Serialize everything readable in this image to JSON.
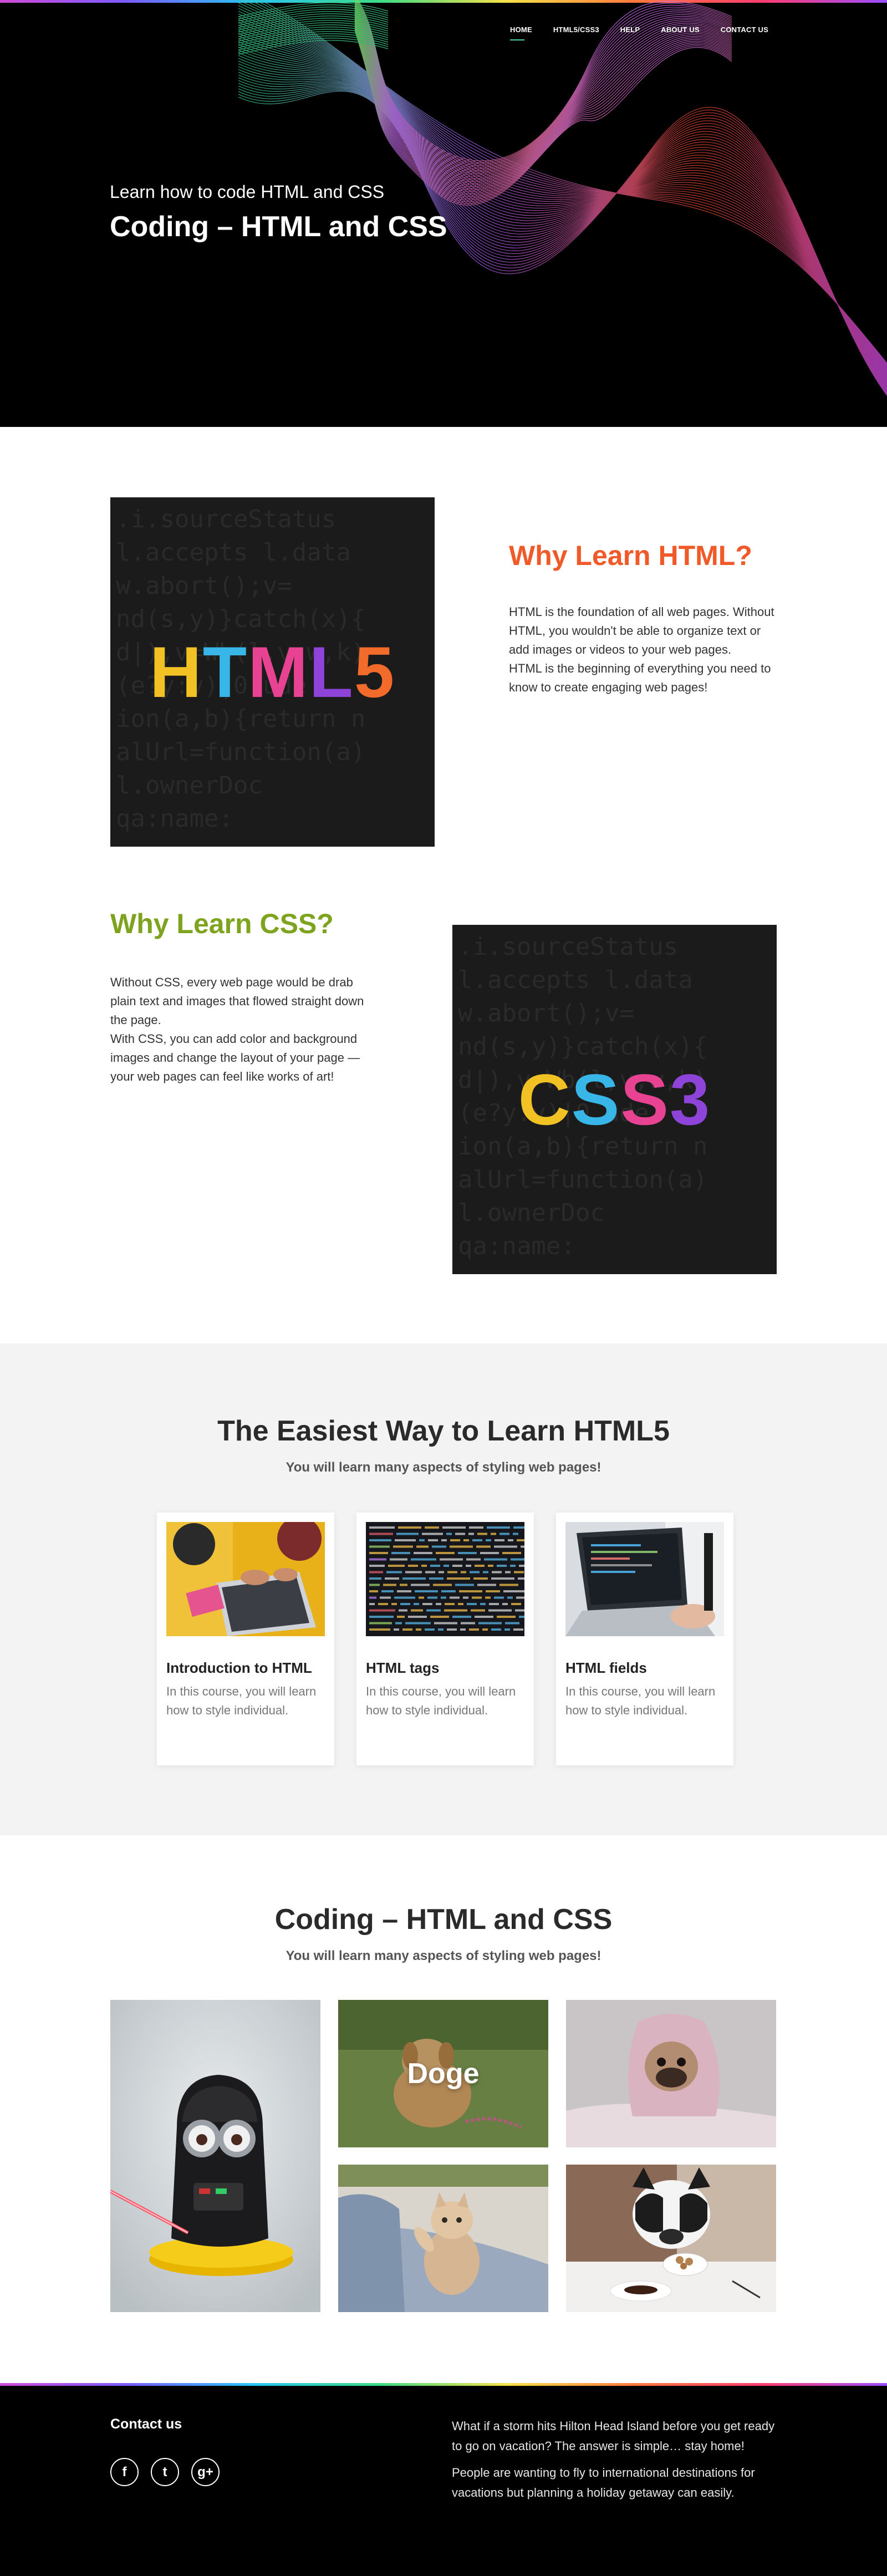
{
  "nav": {
    "items": [
      {
        "label": "HOME",
        "active": true
      },
      {
        "label": "HTML5/CSS3"
      },
      {
        "label": "HELP"
      },
      {
        "label": "ABOUT US"
      },
      {
        "label": "CONTACT US"
      }
    ]
  },
  "hero": {
    "subtitle": "Learn how to code HTML and CSS",
    "title": "Coding – HTML and CSS"
  },
  "html_section": {
    "image_word": "HTML5",
    "heading": "Why Learn HTML?",
    "heading_color": "#f05a28",
    "paragraph_1": "HTML is the foundation of all web pages. Without HTML, you wouldn't be able to organize text or add images or videos to your web pages.",
    "paragraph_2": "HTML is the beginning of everything you need to know to create engaging web pages!"
  },
  "css_section": {
    "image_word": "CSS3",
    "heading": "Why Learn CSS?",
    "heading_color": "#7ea31f",
    "paragraph_1": "Without CSS, every web page would be drab plain text and images that flowed straight down the page.",
    "paragraph_2": "With CSS, you can add color and background images and change the layout of your page — your web pages can feel like works of art!"
  },
  "easy": {
    "heading": "The Easiest Way to Learn HTML5",
    "lead": "You will learn many aspects of styling web pages!",
    "cards": [
      {
        "title": "Introduction to HTML",
        "text": "In this course, you will learn how to style individual."
      },
      {
        "title": "HTML tags",
        "text": "In this course, you will learn how to style individual."
      },
      {
        "title": "HTML fields",
        "text": "In this course, you will learn how to style individual."
      }
    ]
  },
  "gallery": {
    "heading": "Coding – HTML and CSS",
    "lead": "You will learn many aspects of styling web pages!",
    "overlay_label": "Doge"
  },
  "footer": {
    "contact_heading": "Contact us",
    "socials": [
      {
        "icon": "facebook-icon",
        "glyph": "f"
      },
      {
        "icon": "twitter-icon",
        "glyph": "t"
      },
      {
        "icon": "google-plus-icon",
        "glyph": "g+"
      }
    ],
    "text_1": "What if a storm hits Hilton Head Island before you get ready to go on vacation? The answer is simple… stay home!",
    "text_2": "People are wanting to fly to international destinations for vacations but planning a holiday getaway can easily."
  }
}
